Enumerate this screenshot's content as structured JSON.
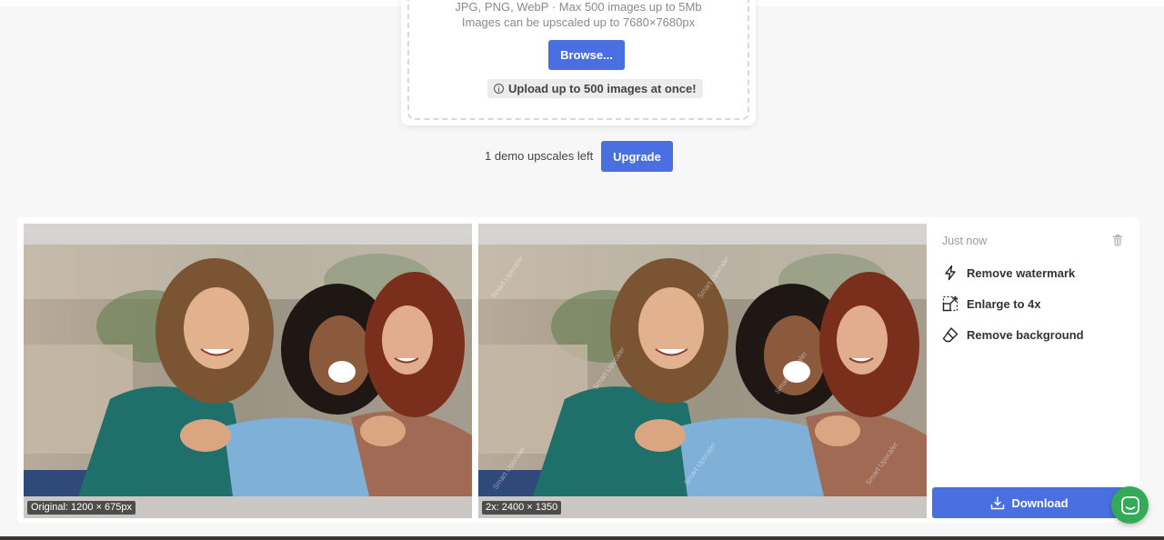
{
  "upload": {
    "formats_text": "JPG, PNG, WebP · Max 500 images up to 5Mb",
    "limit_text": "Images can be upscaled up to 7680×7680px",
    "browse_label": "Browse...",
    "hint_text": "Upload up to 500 images at once!"
  },
  "demo": {
    "remaining_text": "1 demo upscales left",
    "upgrade_label": "Upgrade"
  },
  "result": {
    "timestamp": "Just now",
    "original_label": "Original: 1200 × 675px",
    "upscaled_label": "2x: 2400 × 1350",
    "watermark_text": "Smart Upscaler",
    "actions": [
      {
        "label": "Remove watermark",
        "icon": "lightning-icon"
      },
      {
        "label": "Enlarge to 4x",
        "icon": "enlarge-icon"
      },
      {
        "label": "Remove background",
        "icon": "eraser-icon"
      }
    ],
    "download_label": "Download"
  },
  "colors": {
    "primary": "#4a6fe0",
    "chat": "#33aa55"
  }
}
